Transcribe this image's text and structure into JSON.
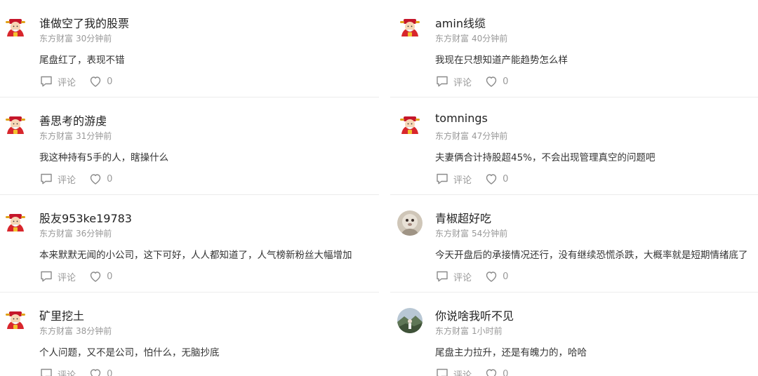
{
  "colors": {
    "username": "#222222",
    "meta": "#999999",
    "text": "#333333",
    "divider": "#ececec"
  },
  "left_column": [
    {
      "username": "谁做空了我的股票",
      "source": "东方财富",
      "time": "30分钟前",
      "text": "尾盘红了，表现不错",
      "avatar_icon": "fortune-god-avatar-icon",
      "comment_label": "评论",
      "like_count": "0"
    },
    {
      "username": "善思考的游虔",
      "source": "东方财富",
      "time": "31分钟前",
      "text": "我这种持有5手的人，瞎操什么",
      "avatar_icon": "fortune-god-avatar-icon",
      "comment_label": "评论",
      "like_count": "0"
    },
    {
      "username": "股友953ke19783",
      "source": "东方财富",
      "time": "36分钟前",
      "text": "本来默默无闻的小公司，这下可好，人人都知道了，人气榜新粉丝大幅增加",
      "avatar_icon": "fortune-god-avatar-icon",
      "comment_label": "评论",
      "like_count": "0"
    },
    {
      "username": "矿里挖土",
      "source": "东方财富",
      "time": "38分钟前",
      "text": "个人问题，又不是公司，怕什么，无脑抄底",
      "avatar_icon": "fortune-god-avatar-icon",
      "comment_label": "评论",
      "like_count": "0"
    }
  ],
  "right_column": [
    {
      "username": "amin线缆",
      "source": "东方财富",
      "time": "40分钟前",
      "text": "我现在只想知道产能趋势怎么样",
      "avatar_icon": "fortune-god-avatar-icon",
      "comment_label": "评论",
      "like_count": "0"
    },
    {
      "username": "tomnings",
      "source": "东方财富",
      "time": "47分钟前",
      "text": "夫妻俩合计持股超45%，不会出现管理真空的问题吧",
      "avatar_icon": "fortune-god-avatar-icon",
      "comment_label": "评论",
      "like_count": "0"
    },
    {
      "username": "青椒超好吃",
      "source": "东方财富",
      "time": "54分钟前",
      "text": "今天开盘后的承接情况还行，没有继续恐慌杀跌，大概率就是短期情绪底了",
      "avatar_icon": "photo-avatar-icon",
      "comment_label": "评论",
      "like_count": "0"
    },
    {
      "username": "你说啥我听不见",
      "source": "东方财富",
      "time": "1小时前",
      "text": "尾盘主力拉升，还是有魄力的，哈哈",
      "avatar_icon": "landscape-photo-avatar-icon",
      "comment_label": "评论",
      "like_count": "0"
    }
  ]
}
